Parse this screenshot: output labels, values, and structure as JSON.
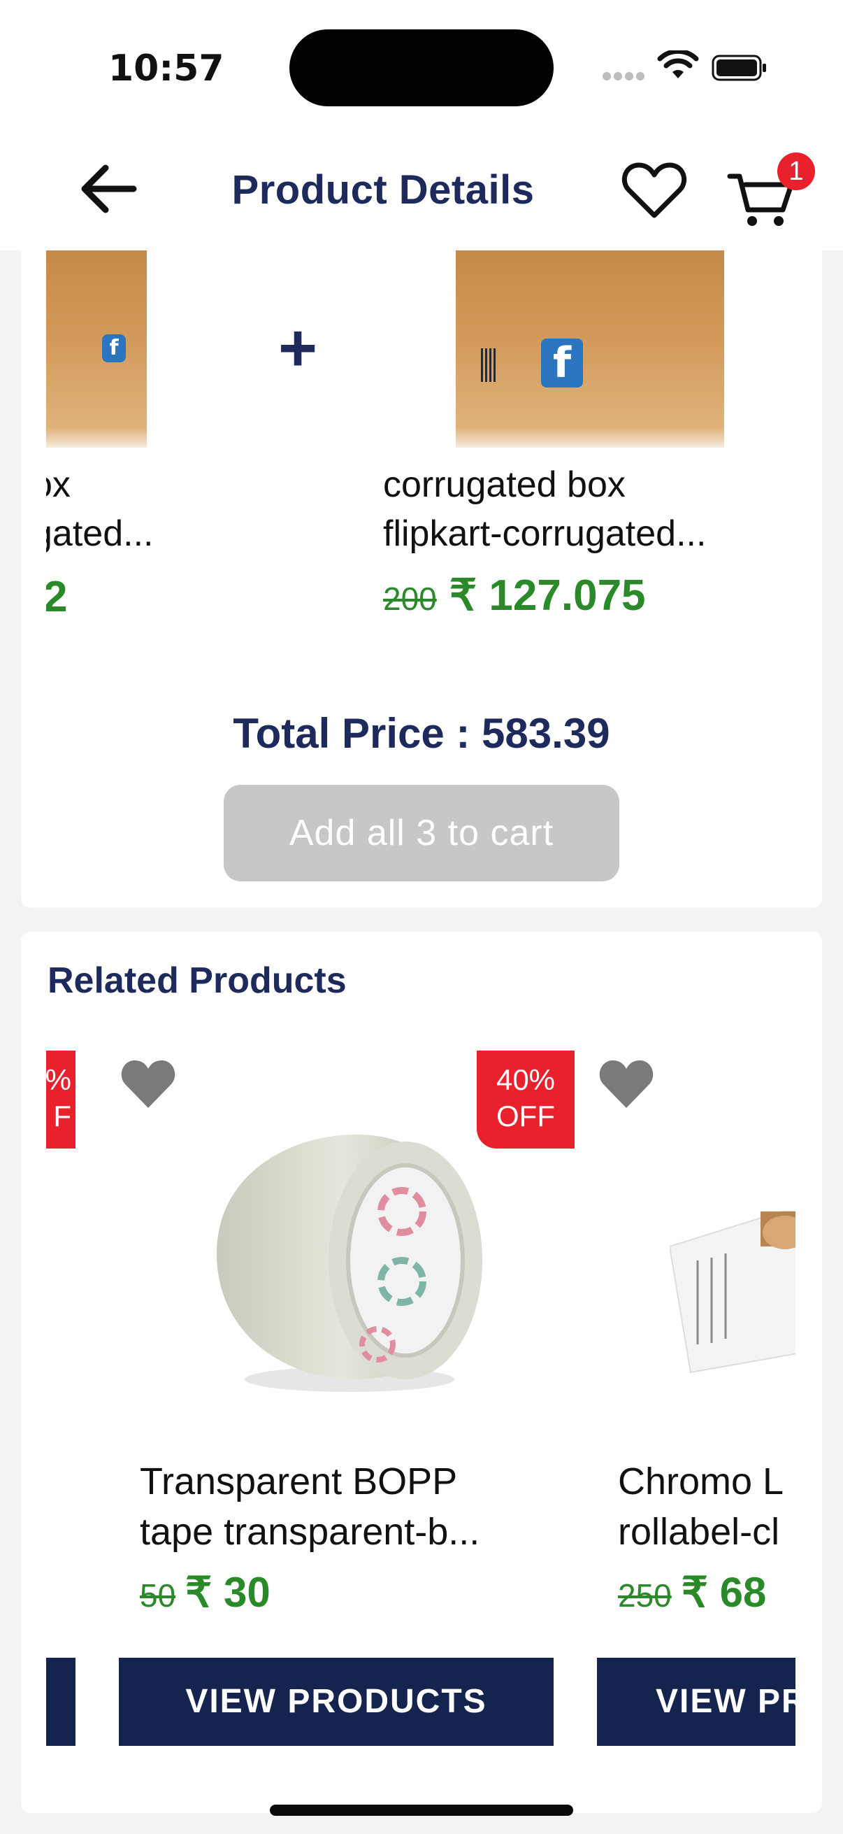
{
  "status_bar": {
    "time": "10:57"
  },
  "header": {
    "title": "Product Details",
    "cart_count": "1",
    "icons": {
      "back": "arrow-left-icon",
      "wishlist": "heart-outline-icon",
      "cart": "cart-icon"
    }
  },
  "bundle": {
    "items": [
      {
        "name_line1": "ox",
        "name_line2": "gated...",
        "price_new": "2"
      },
      {
        "name_line1": "corrugated box",
        "name_line2": "flipkart-corrugated...",
        "price_old": "200",
        "price_new": "₹ 127.075"
      }
    ],
    "plus_symbol": "+",
    "total_price": "Total Price : 583.39",
    "add_all_button": "Add all 3 to cart"
  },
  "related": {
    "title": "Related Products",
    "products": [
      {
        "badge_line1": "%",
        "badge_line2": "F",
        "view_label": ""
      },
      {
        "badge_line1": "40%",
        "badge_line2": "OFF",
        "name_line1": "Transparent BOPP",
        "name_line2": "tape transparent-b...",
        "price_old": "50",
        "price_new": "₹ 30",
        "view_label": "VIEW PRODUCTS"
      },
      {
        "name_line1": "Chromo L",
        "name_line2": "rollabel-cl",
        "price_old": "250",
        "price_new": "₹ 68",
        "view_label": "VIEW PR"
      }
    ]
  },
  "colors": {
    "brand_navy": "#1d2a5b",
    "button_navy": "#15234f",
    "price_green": "#2a8a2a",
    "badge_red": "#e8212d",
    "disabled_gray": "#c7c7c7"
  }
}
